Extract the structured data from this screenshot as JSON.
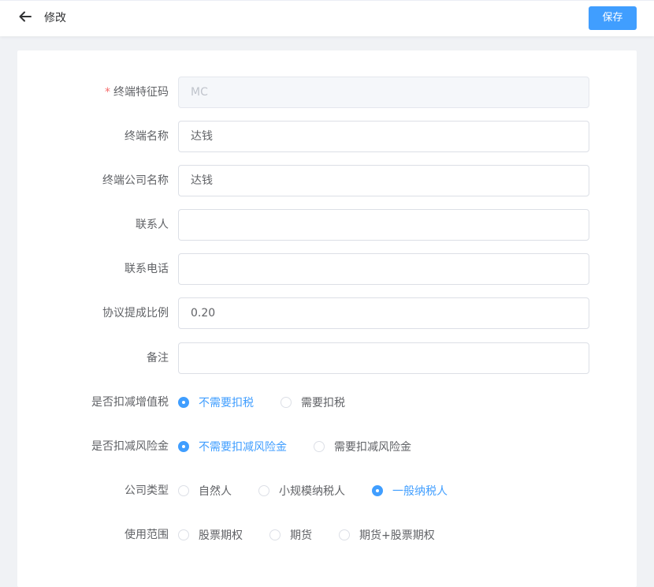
{
  "header": {
    "title": "修改",
    "save_label": "保存"
  },
  "form": {
    "terminal_code": {
      "label": "终端特征码",
      "required_mark": "*",
      "value": "MC"
    },
    "terminal_name": {
      "label": "终端名称",
      "value": "达钱"
    },
    "terminal_company": {
      "label": "终端公司名称",
      "value": "达钱"
    },
    "contact": {
      "label": "联系人",
      "value": ""
    },
    "phone": {
      "label": "联系电话",
      "value": ""
    },
    "commission_ratio": {
      "label": "协议提成比例",
      "value": "0.20"
    },
    "remark": {
      "label": "备注",
      "value": ""
    },
    "vat_deduct": {
      "label": "是否扣减增值税",
      "options": [
        "不需要扣税",
        "需要扣税"
      ],
      "selected": "不需要扣税"
    },
    "risk_deduct": {
      "label": "是否扣减风险金",
      "options": [
        "不需要扣减风险金",
        "需要扣减风险金"
      ],
      "selected": "不需要扣减风险金"
    },
    "company_type": {
      "label": "公司类型",
      "options": [
        "自然人",
        "小规模纳税人",
        "一般纳税人"
      ],
      "selected": "一般纳税人"
    },
    "usage_scope": {
      "label": "使用范围",
      "options": [
        "股票期权",
        "期货",
        "期货+股票期权"
      ],
      "selected": ""
    }
  },
  "colors": {
    "primary": "#409eff",
    "required": "#f56c6c"
  }
}
